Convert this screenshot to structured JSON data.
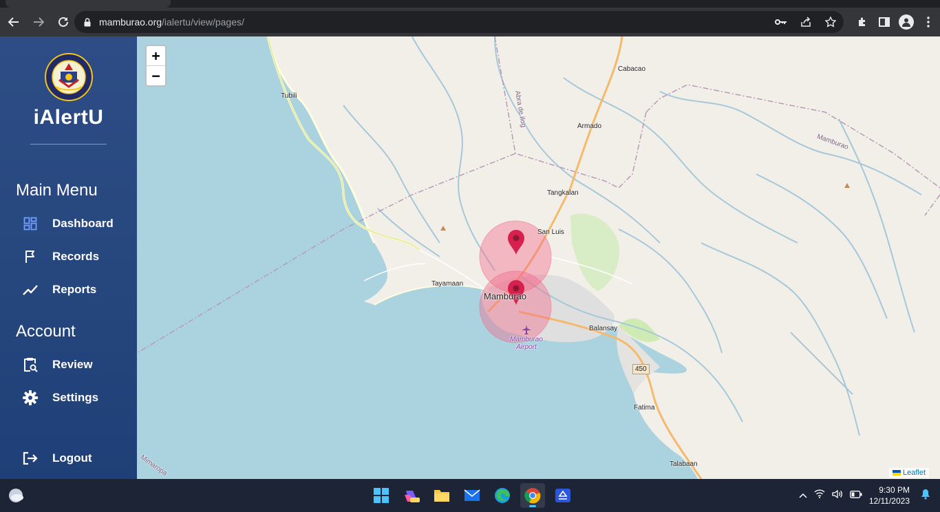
{
  "browser": {
    "url_host": "mamburao.org",
    "url_path": "/ialertu/view/pages/"
  },
  "sidebar": {
    "brand": "iAlertU",
    "main_menu_title": "Main Menu",
    "main_menu": [
      {
        "label": "Dashboard",
        "icon": "dashboard-icon"
      },
      {
        "label": "Records",
        "icon": "flag-icon"
      },
      {
        "label": "Reports",
        "icon": "trend-icon"
      }
    ],
    "account_title": "Account",
    "account_menu": [
      {
        "label": "Review",
        "icon": "clipboard-search-icon"
      },
      {
        "label": "Settings",
        "icon": "gear-icon"
      }
    ],
    "logout": "Logout"
  },
  "map": {
    "zoom_in": "+",
    "zoom_out": "−",
    "attribution": "Leaflet",
    "places": {
      "tubili": "Tubili",
      "cabacao": "Cabacao",
      "abra_de_ilog": "Abra de Ilog",
      "armado": "Armado",
      "mamburao_region": "Mamburao",
      "tangkalan": "Tangkalan",
      "san_luis": "San Luis",
      "tayamaan": "Tayamaan",
      "mamburao_town": "Mamburao",
      "balansay": "Balansay",
      "airport": "Mamburao Airport",
      "road_450": "450",
      "fatima": "Fatima",
      "talabaan": "Talabaan",
      "mimaropa": "Mimaropa"
    },
    "colors": {
      "sea": "#aad3df",
      "land": "#f2efe9",
      "river": "#a5c8d8",
      "marker": "#d6214f",
      "circle": "#f26a8b"
    }
  },
  "taskbar": {
    "time": "9:30 PM",
    "date": "12/11/2023"
  }
}
